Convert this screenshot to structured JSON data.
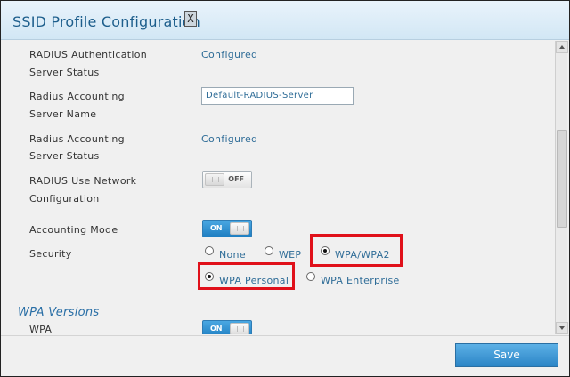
{
  "dialog": {
    "title": "SSID Profile Configuration",
    "close_label": "X"
  },
  "fields": {
    "radius_auth_status_label_1": "RADIUS Authentication",
    "radius_auth_status_label_2": "Server Status",
    "radius_auth_status_value": "Configured",
    "radius_acct_name_label_1": "Radius Accounting",
    "radius_acct_name_label_2": "Server Name",
    "radius_acct_name_value": "Default-RADIUS-Server",
    "radius_acct_status_label_1": "Radius Accounting",
    "radius_acct_status_label_2": "Server Status",
    "radius_acct_status_value": "Configured",
    "radius_use_network_label_1": "RADIUS Use Network",
    "radius_use_network_label_2": "Configuration",
    "radius_use_network_toggle": "OFF",
    "accounting_mode_label": "Accounting Mode",
    "accounting_mode_toggle": "ON",
    "security_label": "Security",
    "security_options": [
      "None",
      "WEP",
      "WPA/WPA2"
    ],
    "security_selected": "WPA/WPA2",
    "wpa_mode_options": [
      "WPA Personal",
      "WPA Enterprise"
    ],
    "wpa_mode_selected": "WPA Personal",
    "wpa_versions_heading": "WPA Versions",
    "wpa_label": "WPA",
    "wpa_toggle": "ON"
  },
  "footer": {
    "save_label": "Save"
  },
  "colors": {
    "highlight": "#e0101a",
    "accent": "#2e6c97",
    "toggle_on": "#1f7fc2"
  }
}
